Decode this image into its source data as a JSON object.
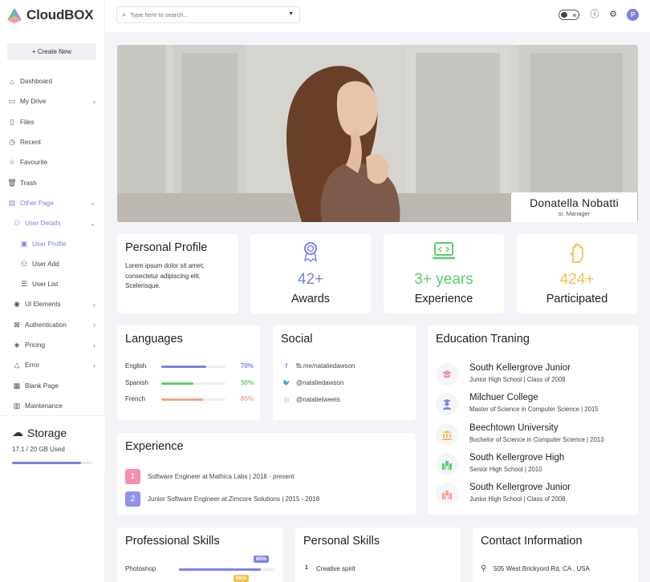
{
  "brand": {
    "name": "CloudBOX"
  },
  "sidebar": {
    "create_label": "Create New",
    "items": [
      {
        "label": "Dashboard",
        "icon": "home-icon"
      },
      {
        "label": "My Drive",
        "icon": "folder-icon"
      },
      {
        "label": "Files",
        "icon": "file-icon"
      },
      {
        "label": "Recent",
        "icon": "clock-icon"
      },
      {
        "label": "Favourite",
        "icon": "star-icon"
      },
      {
        "label": "Trash",
        "icon": "trash-icon"
      },
      {
        "label": "Other Page",
        "icon": "page-icon"
      },
      {
        "label": "User Details",
        "icon": "users-icon"
      },
      {
        "label": "User Profile",
        "icon": "profile-icon"
      },
      {
        "label": "User Add",
        "icon": "user-add-icon"
      },
      {
        "label": "User List",
        "icon": "list-icon"
      },
      {
        "label": "UI Elements",
        "icon": "ui-icon"
      },
      {
        "label": "Authentication",
        "icon": "auth-icon"
      },
      {
        "label": "Pricing",
        "icon": "pricing-icon"
      },
      {
        "label": "Error",
        "icon": "error-icon"
      },
      {
        "label": "Blank Page",
        "icon": "blank-icon"
      },
      {
        "label": "Maintenance",
        "icon": "maintenance-icon"
      }
    ],
    "storage": {
      "title": "Storage",
      "used": "17.1 / 20 GB Used",
      "fraction": 0.855
    }
  },
  "topbar": {
    "search_placeholder": "Type here to search...",
    "avatar_letter": "P"
  },
  "profile": {
    "name": "Donatella Nobatti",
    "role": "sr. Manager"
  },
  "personal_profile": {
    "title": "Personal Profile",
    "text": "Lorem ipsum dolor sit amet, consectetur adipiscing elit. Scelerisque."
  },
  "stats": [
    {
      "value": "42+",
      "label": "Awards",
      "color": "#7b82e6",
      "icon": "award-icon"
    },
    {
      "value": "3+ years",
      "label": "Experience",
      "color": "#5ecb70",
      "icon": "laptop-code-icon"
    },
    {
      "value": "424+",
      "label": "Participated",
      "color": "#f7c04a",
      "icon": "hand-icon"
    }
  ],
  "languages": {
    "title": "Languages",
    "items": [
      {
        "name": "English",
        "pct": "70%",
        "value": 70,
        "color": "#7b82e6"
      },
      {
        "name": "Spanish",
        "pct": "50%",
        "value": 50,
        "color": "#5ecb70"
      },
      {
        "name": "French",
        "pct": "65%",
        "value": 65,
        "color": "#f4a58a"
      }
    ]
  },
  "social": {
    "title": "Social",
    "items": [
      {
        "text": "fb.me/nataliedawson",
        "icon": "facebook-icon",
        "color": "#7b82e6"
      },
      {
        "text": "@nataliedawson",
        "icon": "twitter-icon",
        "color": "#f4a58a"
      },
      {
        "text": "@natalietweets",
        "icon": "instagram-icon",
        "color": "#f4a58a"
      }
    ]
  },
  "education": {
    "title": "Education Traning",
    "items": [
      {
        "title": "South Kellergrove Junior",
        "sub": "Junior High School | Class of 2008",
        "icon": "graduation-cap-icon",
        "color": "#f48fb1"
      },
      {
        "title": "Milchuer College",
        "sub": "Master of Science in Computer Science | 2015",
        "icon": "graduate-icon",
        "color": "#7b82e6"
      },
      {
        "title": "Beechtown University",
        "sub": "Bochelor of Science in Computer Science | 2013",
        "icon": "university-icon",
        "color": "#f7c04a"
      },
      {
        "title": "South Kellergrove High",
        "sub": "Senior High School | 2010",
        "icon": "school-icon",
        "color": "#5ecb70"
      },
      {
        "title": "South Kellergrove Junior",
        "sub": "Junior High School | Class of 2008",
        "icon": "school-icon",
        "color": "#f4a58a"
      }
    ]
  },
  "experience": {
    "title": "Experience",
    "items": [
      {
        "num": "1",
        "text": "Software Engineer at Mathica Labs | 2018 - present",
        "color": "#f48fb1"
      },
      {
        "num": "2",
        "text": "Junior Software Engineer at Zimcore Solutions | 2015 - 2018",
        "color": "#8f94ee"
      }
    ]
  },
  "professional_skills": {
    "title": "Professional Skills",
    "items": [
      {
        "name": "Photoshop",
        "pct": "85%",
        "value": 85,
        "color": "#7b82e6"
      },
      {
        "name": "",
        "pct": "65%",
        "value": 65,
        "color": "#f7c04a"
      }
    ]
  },
  "personal_skills": {
    "title": "Personal Skills",
    "items": [
      {
        "num": "1",
        "text": "Creative spirit"
      }
    ]
  },
  "contact": {
    "title": "Contact Information",
    "address": "505 West Brickyord Rd, CA , USA"
  }
}
